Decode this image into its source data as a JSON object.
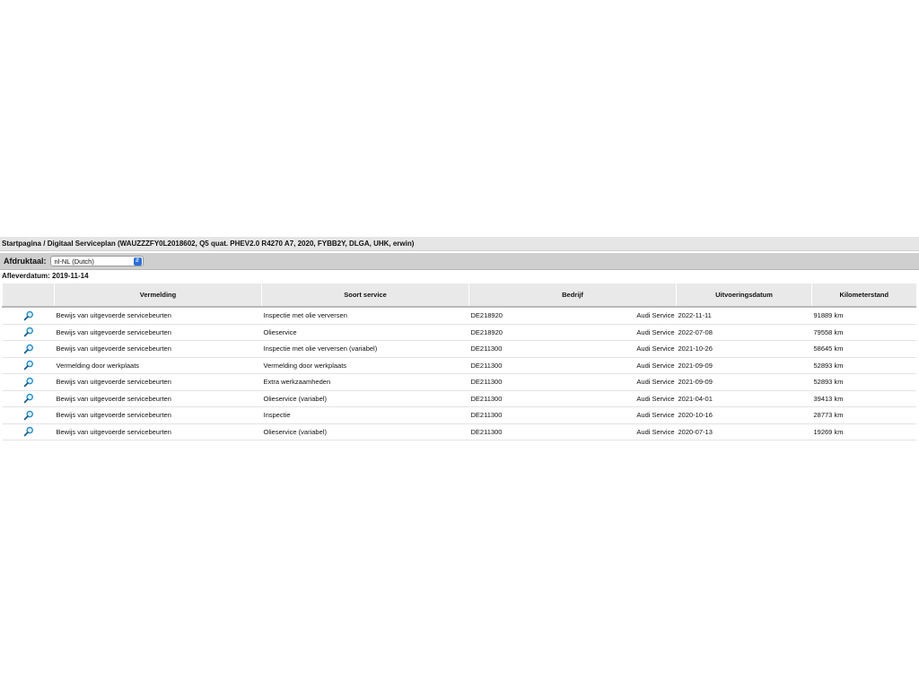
{
  "breadcrumb": {
    "home": "Startpagina",
    "separator": " / ",
    "current": "Digitaal Serviceplan (WAUZZZFY0L2018602, Q5 quat. PHEV2.0 R4270 A7, 2020, FYBB2Y, DLGA, UHK, erwin)"
  },
  "print_language": {
    "label": "Afdruktaal:",
    "selected": "nl-NL (Dutch)"
  },
  "delivery": {
    "label": "Afleverdatum:",
    "value": "2019-11-14"
  },
  "table": {
    "headers": {
      "vermelding": "Vermelding",
      "soort": "Soort service",
      "bedrijf": "Bedrijf",
      "datum": "Uitvoeringsdatum",
      "km": "Kilometerstand"
    },
    "icon": "magnifier-icon",
    "rows": [
      {
        "vermelding": "Bewijs van uitgevoerde servicebeurten",
        "soort": "Inspectie met olie verversen",
        "code": "DE218920",
        "brand": "Audi Service",
        "datum": "2022-11-11",
        "km": "91889 km"
      },
      {
        "vermelding": "Bewijs van uitgevoerde servicebeurten",
        "soort": "Olieservice",
        "code": "DE218920",
        "brand": "Audi Service",
        "datum": "2022-07-08",
        "km": "79558 km"
      },
      {
        "vermelding": "Bewijs van uitgevoerde servicebeurten",
        "soort": "Inspectie met olie verversen (variabel)",
        "code": "DE211300",
        "brand": "Audi Service",
        "datum": "2021-10-26",
        "km": "58645 km"
      },
      {
        "vermelding": "Vermelding door werkplaats",
        "soort": "Vermelding door werkplaats",
        "code": "DE211300",
        "brand": "Audi Service",
        "datum": "2021-09-09",
        "km": "52893 km"
      },
      {
        "vermelding": "Bewijs van uitgevoerde servicebeurten",
        "soort": "Extra werkzaamheden",
        "code": "DE211300",
        "brand": "Audi Service",
        "datum": "2021-09-09",
        "km": "52893 km"
      },
      {
        "vermelding": "Bewijs van uitgevoerde servicebeurten",
        "soort": "Olieservice (variabel)",
        "code": "DE211300",
        "brand": "Audi Service",
        "datum": "2021-04-01",
        "km": "39413 km"
      },
      {
        "vermelding": "Bewijs van uitgevoerde servicebeurten",
        "soort": "Inspectie",
        "code": "DE211300",
        "brand": "Audi Service",
        "datum": "2020-10-16",
        "km": "28773 km"
      },
      {
        "vermelding": "Bewijs van uitgevoerde servicebeurten",
        "soort": "Olieservice (variabel)",
        "code": "DE211300",
        "brand": "Audi Service",
        "datum": "2020-07-13",
        "km": "19269 km"
      }
    ]
  },
  "colors": {
    "magnifier": "#2a8fc9",
    "select_chevron": "#2b6fd6"
  }
}
